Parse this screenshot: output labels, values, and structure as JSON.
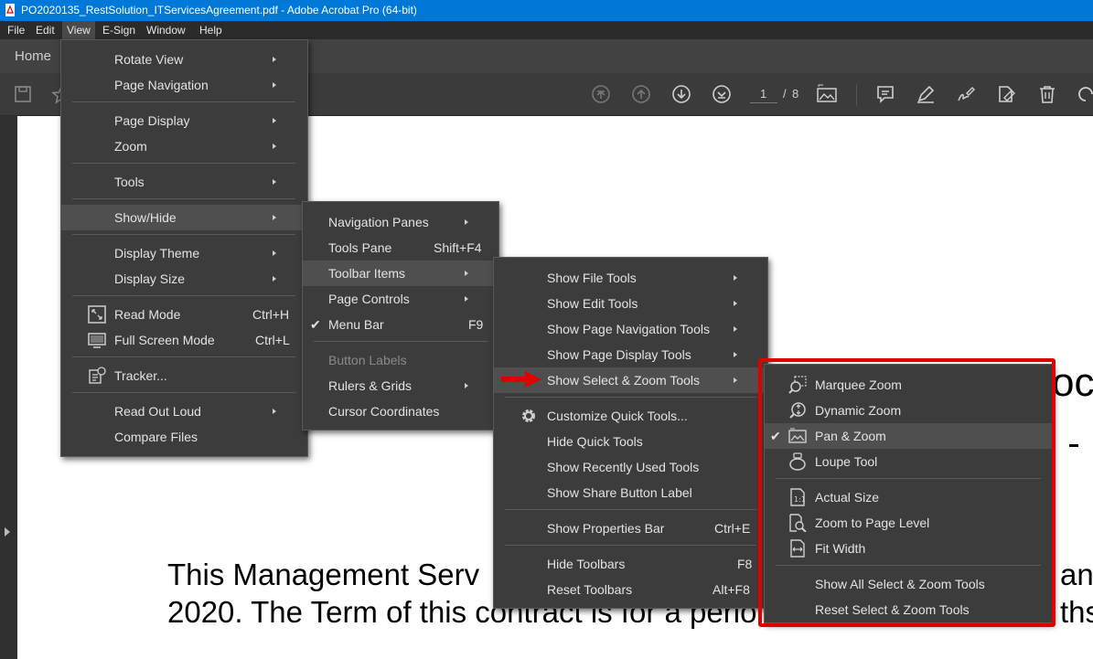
{
  "window": {
    "title": "PO2020135_RestSolution_ITServicesAgreement.pdf - Adobe Acrobat Pro (64-bit)"
  },
  "menubar": [
    "File",
    "Edit",
    "View",
    "E-Sign",
    "Window",
    "Help"
  ],
  "tabs": {
    "home": "Home"
  },
  "toolbar": {
    "page_current": "1",
    "page_sep": "/",
    "page_total": "8"
  },
  "view_menu": [
    {
      "label": "Rotate View",
      "arrow": true
    },
    {
      "label": "Page Navigation",
      "arrow": true
    },
    {
      "label": "Page Display",
      "arrow": true
    },
    {
      "label": "Zoom",
      "arrow": true
    },
    {
      "label": "Tools",
      "arrow": true
    },
    {
      "label": "Show/Hide",
      "arrow": true
    },
    {
      "label": "Display Theme",
      "arrow": true
    },
    {
      "label": "Display Size",
      "arrow": true
    },
    {
      "label": "Read Mode",
      "shortcut": "Ctrl+H"
    },
    {
      "label": "Full Screen Mode",
      "shortcut": "Ctrl+L"
    },
    {
      "label": "Tracker..."
    },
    {
      "label": "Read Out Loud",
      "arrow": true
    },
    {
      "label": "Compare Files"
    }
  ],
  "showhide_menu": [
    {
      "label": "Navigation Panes",
      "arrow": true
    },
    {
      "label": "Tools Pane",
      "shortcut": "Shift+F4"
    },
    {
      "label": "Toolbar Items",
      "arrow": true
    },
    {
      "label": "Page Controls",
      "arrow": true
    },
    {
      "label": "Menu Bar",
      "shortcut": "F9",
      "checked": true
    },
    {
      "label": "Button Labels",
      "disabled": true
    },
    {
      "label": "Rulers & Grids",
      "arrow": true
    },
    {
      "label": "Cursor Coordinates"
    }
  ],
  "toolbar_items_menu": [
    {
      "label": "Show File Tools",
      "arrow": true
    },
    {
      "label": "Show Edit Tools",
      "arrow": true
    },
    {
      "label": "Show Page Navigation Tools",
      "arrow": true
    },
    {
      "label": "Show Page Display Tools",
      "arrow": true
    },
    {
      "label": "Show Select & Zoom Tools",
      "arrow": true
    },
    {
      "label": "Customize Quick Tools..."
    },
    {
      "label": "Hide Quick Tools"
    },
    {
      "label": "Show Recently Used Tools"
    },
    {
      "label": "Show Share Button Label"
    },
    {
      "label": "Show Properties Bar",
      "shortcut": "Ctrl+E"
    },
    {
      "label": "Hide Toolbars",
      "shortcut": "F8"
    },
    {
      "label": "Reset Toolbars",
      "shortcut": "Alt+F8"
    }
  ],
  "select_zoom_menu": [
    {
      "label": "Marquee Zoom",
      "icon": "marquee-zoom-icon"
    },
    {
      "label": "Dynamic Zoom",
      "icon": "dynamic-zoom-icon"
    },
    {
      "label": "Pan & Zoom",
      "icon": "pan-zoom-icon",
      "checked": true
    },
    {
      "label": "Loupe Tool",
      "icon": "loupe-icon"
    },
    {
      "label": "Actual Size",
      "icon": "actual-size-icon"
    },
    {
      "label": "Zoom to Page Level",
      "icon": "zoom-page-icon"
    },
    {
      "label": "Fit Width",
      "icon": "fit-width-icon"
    },
    {
      "label": "Show All Select & Zoom Tools"
    },
    {
      "label": "Reset Select & Zoom Tools"
    }
  ],
  "document": {
    "line1_left": "This  Management  Serv",
    "line1_right": "an",
    "line2_left": "2020. The Term of this contract is for a perio",
    "line2_right": "ths",
    "heading_fragment": "oc"
  },
  "colors": {
    "titlebar": "#0078d7",
    "highlight_box": "#e00000"
  }
}
